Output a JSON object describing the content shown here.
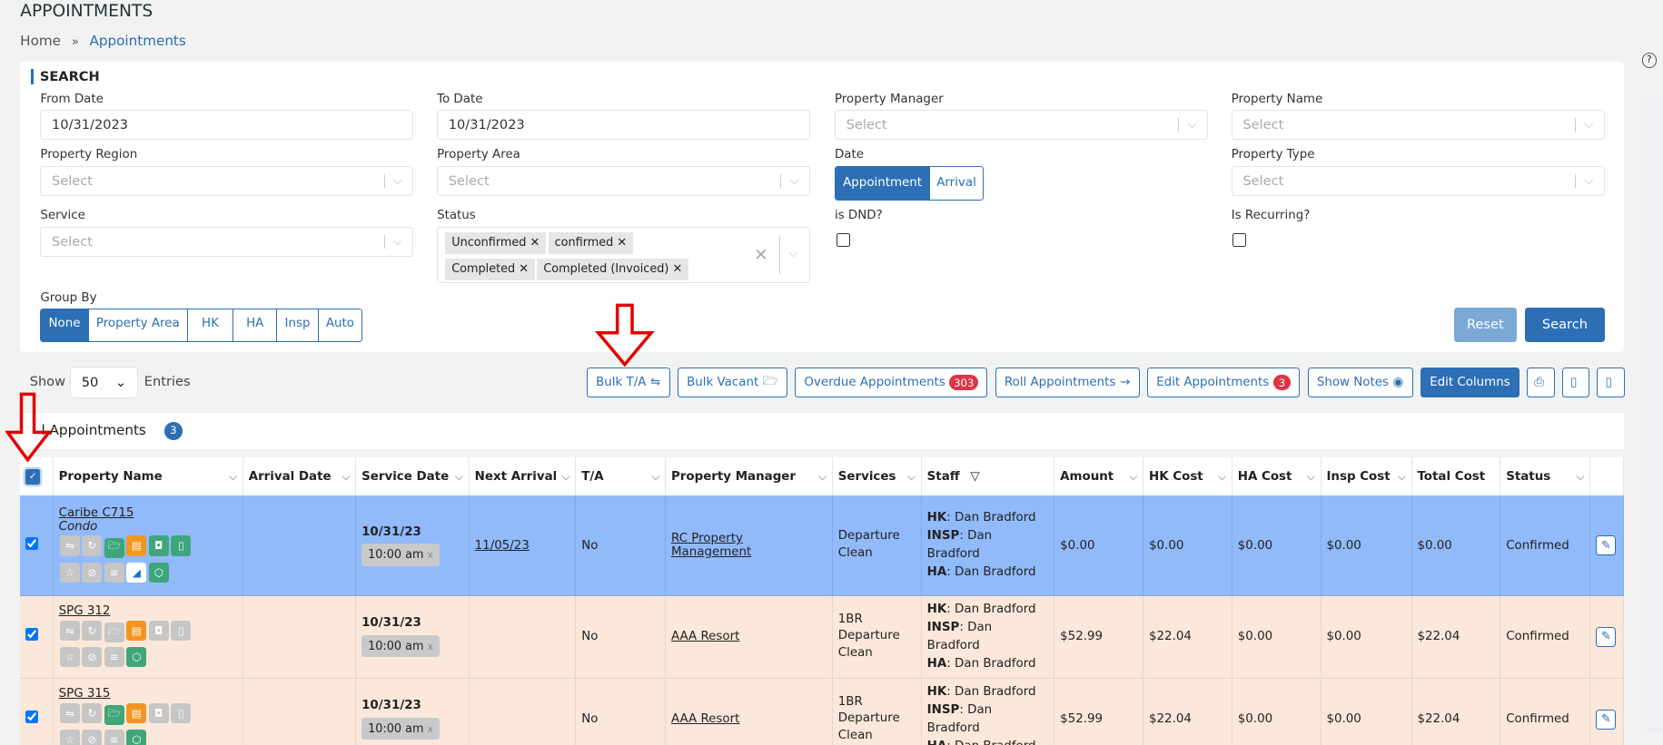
{
  "header": {
    "title": "APPOINTMENTS",
    "breadcrumb": {
      "home": "Home",
      "sep": "»",
      "current": "Appointments"
    },
    "help_icon": "question-circle-icon"
  },
  "search": {
    "title": "SEARCH",
    "from_date": {
      "label": "From Date",
      "value": "10/31/2023"
    },
    "to_date": {
      "label": "To Date",
      "value": "10/31/2023"
    },
    "property_manager": {
      "label": "Property Manager",
      "placeholder": "Select"
    },
    "property_name": {
      "label": "Property Name",
      "placeholder": "Select"
    },
    "property_region": {
      "label": "Property Region",
      "placeholder": "Select"
    },
    "property_area": {
      "label": "Property Area",
      "placeholder": "Select"
    },
    "date": {
      "label": "Date",
      "options": [
        "Appointment",
        "Arrival"
      ],
      "selected": "Appointment"
    },
    "property_type": {
      "label": "Property Type",
      "placeholder": "Select"
    },
    "service": {
      "label": "Service",
      "placeholder": "Select"
    },
    "status": {
      "label": "Status",
      "chips": [
        "Unconfirmed",
        "confirmed",
        "Completed",
        "Completed (Invoiced)"
      ]
    },
    "is_dnd": {
      "label": "is DND?",
      "checked": false
    },
    "is_recurring": {
      "label": "Is Recurring?",
      "checked": false
    },
    "group_by": {
      "label": "Group By",
      "options": [
        "None",
        "Property Area",
        "HK",
        "HA",
        "Insp",
        "Auto"
      ],
      "selected": "None"
    },
    "reset": "Reset",
    "search": "Search"
  },
  "toolbar": {
    "show": "Show",
    "entries_value": "50",
    "entries": "Entries",
    "bulk_ta": "Bulk T/A",
    "bulk_vacant": "Bulk Vacant",
    "overdue": "Overdue Appointments",
    "overdue_count": "303",
    "roll": "Roll Appointments",
    "edit_appts": "Edit Appointments",
    "edit_count": "3",
    "show_notes": "Show Notes",
    "edit_columns": "Edit Columns"
  },
  "list": {
    "title": "l Appointments",
    "count": "3"
  },
  "table": {
    "columns": [
      "Property Name",
      "Arrival Date",
      "Service Date",
      "Next Arrival",
      "T/A",
      "Property Manager",
      "Services",
      "Staff",
      "Amount",
      "HK Cost",
      "HA Cost",
      "Insp Cost",
      "Total Cost",
      "Status"
    ],
    "rows": [
      {
        "name": "Caribe C715",
        "type": "Condo",
        "service_date": "10/31/23",
        "time": "10:00 am",
        "next_arrival": "11/05/23",
        "ta": "No",
        "manager": "RC Property Management",
        "services": "Departure Clean",
        "hk": "Dan Bradford",
        "insp": "Dan Bradford",
        "ha": "Dan Bradford",
        "amount": "$0.00",
        "hk_cost": "$0.00",
        "ha_cost": "$0.00",
        "insp_cost": "$0.00",
        "total": "$0.00",
        "status": "Confirmed",
        "selected": true
      },
      {
        "name": "SPG 312",
        "type": "",
        "service_date": "10/31/23",
        "time": "10:00 am",
        "next_arrival": "",
        "ta": "No",
        "manager": "AAA Resort",
        "services": "1BR Departure Clean",
        "hk": "Dan Bradford",
        "insp": "Dan Bradford",
        "ha": "Dan Bradford",
        "amount": "$52.99",
        "hk_cost": "$22.04",
        "ha_cost": "$0.00",
        "insp_cost": "$0.00",
        "total": "$22.04",
        "status": "Confirmed",
        "selected": true
      },
      {
        "name": "SPG 315",
        "type": "",
        "service_date": "10/31/23",
        "time": "10:00 am",
        "next_arrival": "",
        "ta": "No",
        "manager": "AAA Resort",
        "services": "1BR Departure Clean",
        "hk": "Dan Bradford",
        "insp": "Dan Bradford",
        "ha": "Dan Bradford",
        "amount": "$52.99",
        "hk_cost": "$22.04",
        "ha_cost": "$0.00",
        "insp_cost": "$0.00",
        "total": "$22.04",
        "status": "Confirmed",
        "selected": true
      }
    ],
    "staff_labels": {
      "hk": "HK",
      "insp": "INSP",
      "ha": "HA"
    }
  },
  "colors": {
    "primary": "#2c6fb5",
    "selected_row": "#91bafb",
    "row": "#fce8da",
    "badge": "#dc3545",
    "annotation_arrow": "#e00000"
  }
}
